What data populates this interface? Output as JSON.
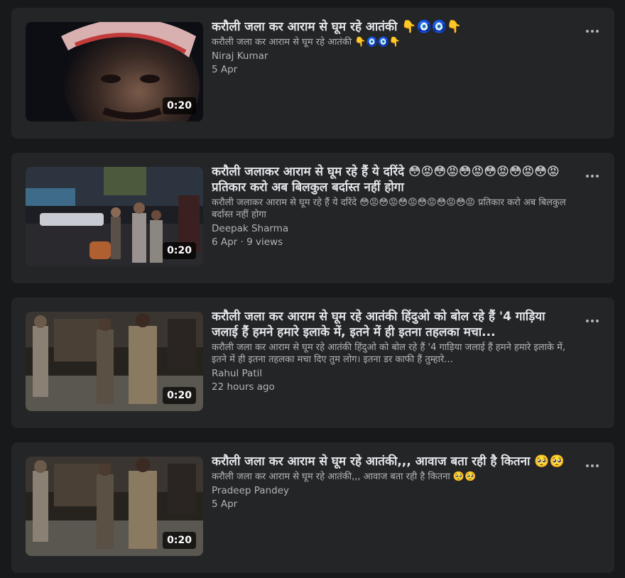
{
  "videos": [
    {
      "title": "करौली जला कर आराम से घूम रहे आतंकी 👇🧿🧿👇",
      "description": "करौली जला कर आराम से घूम रहे आतंकी 👇🧿🧿👇",
      "author": "Niraj Kumar",
      "meta": "5 Apr",
      "duration": "0:20"
    },
    {
      "title": "करौली जलाकर आराम से घूम रहे हैं ये दरिंदे 😳😡😳😡😳😡😳😡😳😡😳😡 प्रतिकार करो अब बिलकुल बर्दास्त नहीं होगा",
      "description": "करौली जलाकर आराम से घूम रहे हैं ये दरिंदे 😳😡😳😡😳😡😳😡😳😡😳😡 प्रतिकार करो अब बिलकुल बर्दास्त नहीं होगा",
      "author": "Deepak Sharma",
      "meta": "6 Apr · 9 views",
      "duration": "0:20"
    },
    {
      "title": "करौली जला कर आराम से घूम रहे आतंकी हिंदुओ को बोल रहे हैं '4 गाड़िया जलाई हैं हमने हमारे इलाके में, इतने में ही इतना तहलका मचा...",
      "description": "करौली जला कर आराम से घूम रहे आतंकी हिंदुओ को बोल रहे हैं '4 गाड़िया जलाई हैं हमने हमारे इलाके में, इतने में ही इतना तहलका मचा दिए तुम लोग। इतना डर काफी हैं तुम्हारे...",
      "author": "Rahul Patil",
      "meta": "22 hours ago",
      "duration": "0:20"
    },
    {
      "title": "करौली जला कर आराम से घूम रहे आतंकी,,, आवाज बता रही है कितना 🥺🥺",
      "description": "करौली जला कर आराम से घूम रहे आतंकी,,, आवाज बता रही है कितना 🥺🥺",
      "author": "Pradeep Pandey",
      "meta": "5 Apr",
      "duration": "0:20"
    }
  ]
}
